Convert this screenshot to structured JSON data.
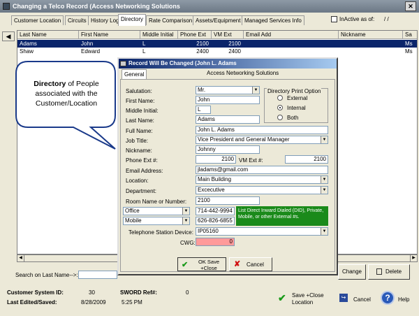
{
  "window": {
    "title": "Changing a Telco Record  (Access Networking Solutions",
    "close_label": "✕"
  },
  "tabs": [
    "Customer Location",
    "Circuits",
    "History Log",
    "Directory",
    "Rate Comparison",
    "Assets/Equipment",
    "Managed Services Info"
  ],
  "inactive": {
    "label": "InActive as of:",
    "date": "/  /"
  },
  "grid": {
    "headers": [
      "Last Name",
      "First Name",
      "Middle Initial",
      "Phone Ext",
      "VM Ext",
      "Email Add",
      "Nickname",
      "Sa"
    ],
    "rows": [
      [
        "Adams",
        "John",
        "L",
        "2100",
        "2100",
        "",
        "",
        "Ms"
      ],
      [
        "Shaw",
        "Edward",
        "L",
        "2400",
        "2400",
        "",
        "",
        "Ms"
      ]
    ]
  },
  "callout": {
    "bold": "Directory",
    "text": " of People associated with the Customer/Location"
  },
  "search": {
    "label": "Search on Last Name-->:"
  },
  "buttons": {
    "change": "Change",
    "delete": "Delete"
  },
  "footer": {
    "system_id_label": "Customer System ID:",
    "system_id": "30",
    "sword_label": "SWORD Ref#:",
    "sword": "0",
    "edited_label": "Last Edited/Saved:",
    "edited_date": "8/28/2009",
    "edited_time": "5:25 PM",
    "save_close": "Save +Close Location",
    "cancel": "Cancel",
    "help": "Help"
  },
  "dialog": {
    "title": "Record Will Be Changed  (John L. Adams",
    "tab": "General",
    "company": "Access Networking Solutions",
    "labels": {
      "salutation": "Salutation:",
      "first": "First Name:",
      "middle": "Middle Initial:",
      "last": "Last Name:",
      "full": "Full Name:",
      "job": "Job Title:",
      "nickname": "Nickname:",
      "phone": "Phone Ext #:",
      "vm": "VM Ext #:",
      "email": "Email Address:",
      "location": "Location:",
      "department": "Department:",
      "room": "Room Name or Number:",
      "station": "Telephone Station Device:",
      "cwg": "CWG:"
    },
    "values": {
      "salutation": "Mr.",
      "first": "John",
      "middle": "L",
      "last": "Adams",
      "full": "John L. Adams",
      "job": "Vice President and General Manager",
      "nickname": "Johnny",
      "phone": "2100",
      "vm": "2100",
      "email": "jladams@gmail.com",
      "location": "Main Building",
      "department": "Excecutive",
      "room": "2100",
      "phone1_type": "Office",
      "phone1": "714-442-9994",
      "phone2_type": "Mobile",
      "phone2": "626-826-6855",
      "station": "IP05160",
      "cwg": "0"
    },
    "print_option": {
      "title": "Directory Print Option",
      "options": [
        "External",
        "Internal",
        "Both"
      ],
      "selected": "Internal"
    },
    "note": "List Direct Inward Dialed (DID), Private, Mobile, or other External #s.",
    "ok": "OK Save +Close",
    "cancel": "Cancel"
  },
  "colors": {
    "note_bg": "#1a8a1a",
    "cwg_bg": "#ff9a9a",
    "selection": "#0a246a"
  }
}
